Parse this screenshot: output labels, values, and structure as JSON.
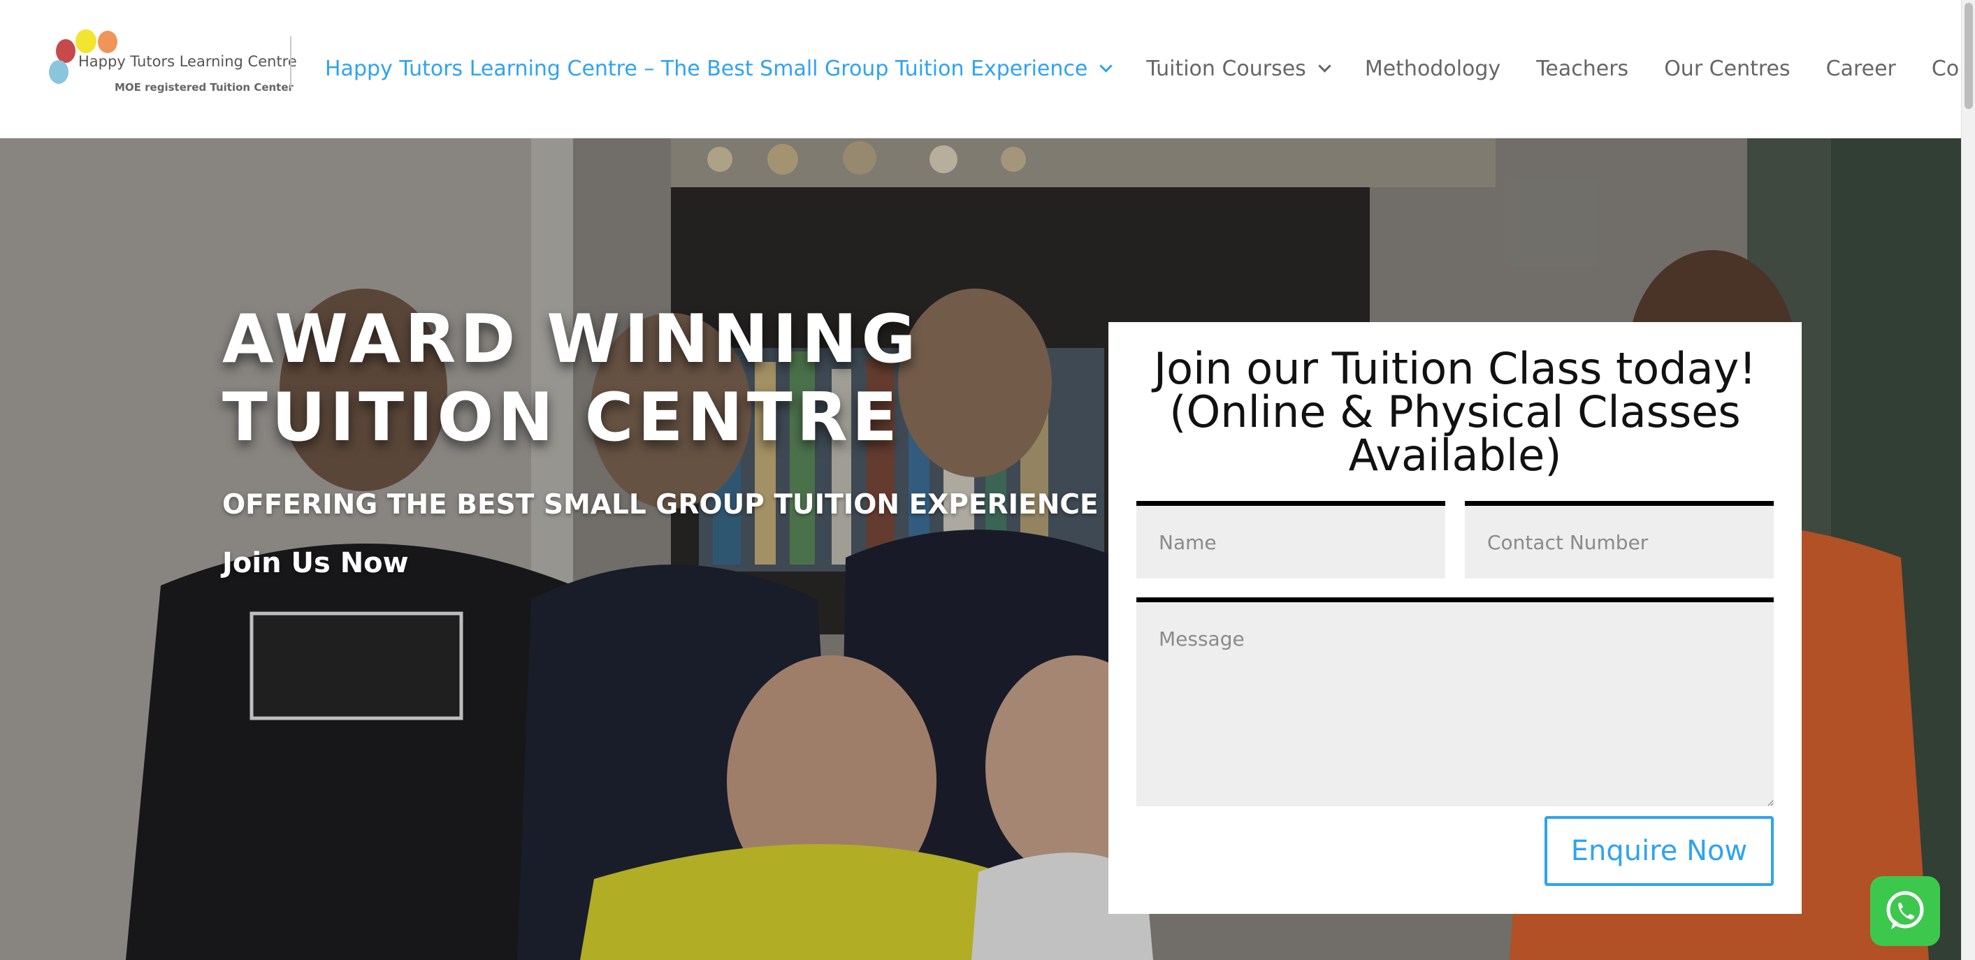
{
  "brand": {
    "name": "Happy Tutors Learning Centre",
    "tagline": "MOE registered Tuition Center",
    "colors": {
      "accent": "#2ea3f2",
      "nav_text": "#666666",
      "logo_red": "#c8494a",
      "logo_yellow": "#f2e52f",
      "logo_orange": "#f0945a",
      "logo_blue": "#89c6dd"
    }
  },
  "nav": {
    "items": [
      {
        "label": "Happy Tutors Learning Centre – The Best Small Group Tuition Experience",
        "active": true,
        "has_dropdown": true
      },
      {
        "label": "Tuition Courses",
        "active": false,
        "has_dropdown": true
      },
      {
        "label": "Methodology",
        "active": false,
        "has_dropdown": false
      },
      {
        "label": "Teachers",
        "active": false,
        "has_dropdown": false
      },
      {
        "label": "Our Centres",
        "active": false,
        "has_dropdown": false
      },
      {
        "label": "Career",
        "active": false,
        "has_dropdown": false
      },
      {
        "label": "Contact Us",
        "active": false,
        "has_dropdown": false
      }
    ],
    "dropdown_icon": "chevron-down-icon"
  },
  "hero": {
    "heading_line1": "AWARD WINNING",
    "heading_line2": "TUITION CENTRE",
    "subheading": "OFFERING THE BEST SMALL GROUP TUITION EXPERIENCE",
    "cta": "Join Us Now"
  },
  "form": {
    "title_line1": "Join our Tuition Class today!",
    "title_line2": "(Online & Physical Classes",
    "title_line3": "Available)",
    "name_placeholder": "Name",
    "contact_placeholder": "Contact Number",
    "message_placeholder": "Message",
    "submit_label": "Enquire Now"
  },
  "whatsapp": {
    "icon": "whatsapp-icon",
    "color": "#3cc84d"
  }
}
